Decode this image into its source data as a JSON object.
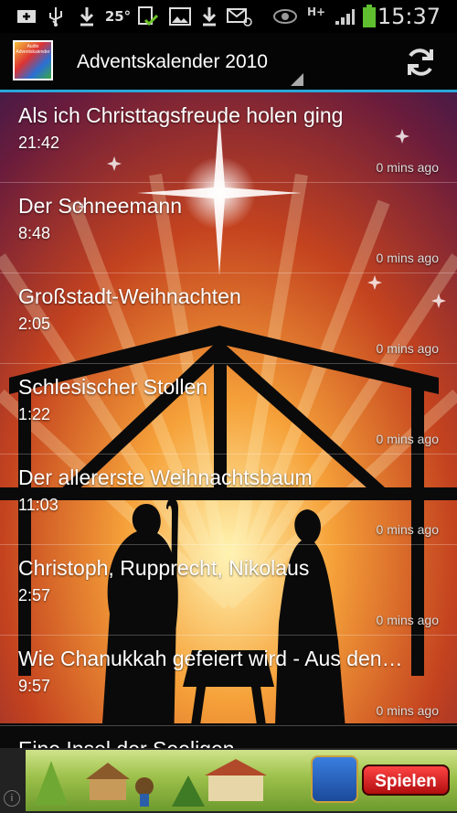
{
  "status_bar": {
    "temperature": "25°",
    "network": "H+",
    "time": "15:37"
  },
  "app_bar": {
    "logo_text": "Audio Adventskalender",
    "title": "Adventskalender 2010"
  },
  "episodes": [
    {
      "title": "Als ich Christtagsfreude holen ging",
      "duration": "21:42",
      "age": "0 mins ago"
    },
    {
      "title": "Der Schneemann",
      "duration": "8:48",
      "age": "0 mins ago"
    },
    {
      "title": "Großstadt-Weihnachten",
      "duration": "2:05",
      "age": "0 mins ago"
    },
    {
      "title": "Schlesischer Stollen",
      "duration": "1:22",
      "age": "0 mins ago"
    },
    {
      "title": "Der allererste Weihnachtsbaum",
      "duration": "11:03",
      "age": "0 mins ago"
    },
    {
      "title": "Christoph, Rupprecht, Nikolaus",
      "duration": "2:57",
      "age": "0 mins ago"
    },
    {
      "title": "Wie Chanukkah gefeiert wird - Aus den…",
      "duration": "9:57",
      "age": "0 mins ago"
    },
    {
      "title": "Eine Insel der Seeligen",
      "duration": "",
      "age": ""
    }
  ],
  "ad": {
    "cta": "Spielen",
    "info": "i"
  }
}
